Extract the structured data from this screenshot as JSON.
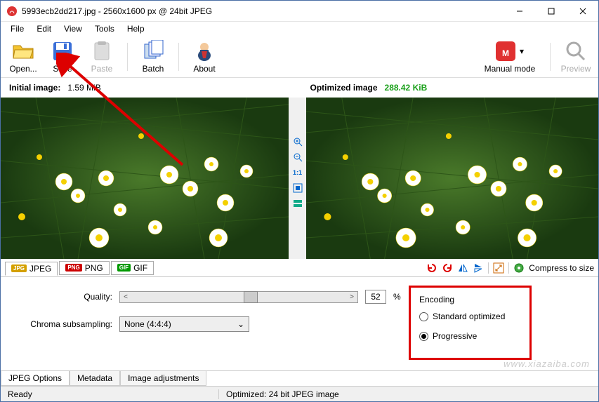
{
  "titlebar": {
    "filename": "5993ecb2dd217.jpg",
    "dims": "2560x1600 px @ 24bit JPEG"
  },
  "menu": {
    "file": "File",
    "edit": "Edit",
    "view": "View",
    "tools": "Tools",
    "help": "Help"
  },
  "toolbar": {
    "open": "Open...",
    "save": "Save",
    "paste": "Paste",
    "batch": "Batch",
    "about": "About",
    "manual_mode": "Manual mode",
    "preview": "Preview"
  },
  "compare": {
    "initial_label": "Initial image:",
    "initial_size": "1.59 MiB",
    "optimized_label": "Optimized image",
    "optimized_size": "288.42 KiB"
  },
  "midtools": {
    "one_to_one": "1:1"
  },
  "format_tabs": {
    "jpeg": "JPEG",
    "png": "PNG",
    "gif": "GIF"
  },
  "toolstrip": {
    "compress": "Compress to size"
  },
  "options": {
    "quality_label": "Quality:",
    "quality_value": "52",
    "quality_pct": "%",
    "chroma_label": "Chroma subsampling:",
    "chroma_value": "None (4:4:4)"
  },
  "encoding": {
    "header": "Encoding",
    "standard": "Standard optimized",
    "progressive": "Progressive"
  },
  "bottom_tabs": {
    "jpeg": "JPEG Options",
    "meta": "Metadata",
    "adjust": "Image adjustments"
  },
  "status": {
    "ready": "Ready",
    "info": "Optimized: 24 bit JPEG image"
  },
  "watermark": "www.xiazaiba.com"
}
